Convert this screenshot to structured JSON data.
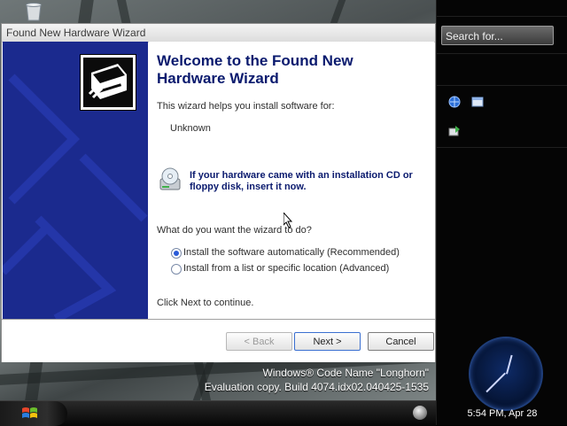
{
  "wizard": {
    "window_title": "Found New Hardware Wizard",
    "heading": "Welcome to the Found New Hardware Wizard",
    "intro": "This wizard helps you install software for:",
    "device_name": "Unknown",
    "cd_note": "If your hardware came with an installation CD or floppy disk, insert it now.",
    "question": "What do you want the wizard to do?",
    "options": [
      {
        "label": "Install the software automatically (Recommended)",
        "selected": true
      },
      {
        "label": "Install from a list or specific location (Advanced)",
        "selected": false
      }
    ],
    "continue_text": "Click Next to continue.",
    "back_label": "< Back",
    "next_label": "Next >",
    "cancel_label": "Cancel"
  },
  "sidebar": {
    "search_placeholder": "Search for...",
    "clock_time": "5:54 PM, Apr 28"
  },
  "watermark": {
    "line1": "Windows® Code Name \"Longhorn\"",
    "line2": "Evaluation copy. Build 4074.idx02.040425-1535"
  },
  "colors": {
    "wizard_panel": "#1b2a8e",
    "heading": "#0a1a6e",
    "sidebar": "#050505"
  },
  "icons": [
    "recycle-bin-icon",
    "hardware-icon",
    "cd-floppy-icon",
    "sidebar-network-icon",
    "sidebar-window-icon",
    "sidebar-tray-icon",
    "windows-logo-icon",
    "mouse-cursor-icon"
  ]
}
